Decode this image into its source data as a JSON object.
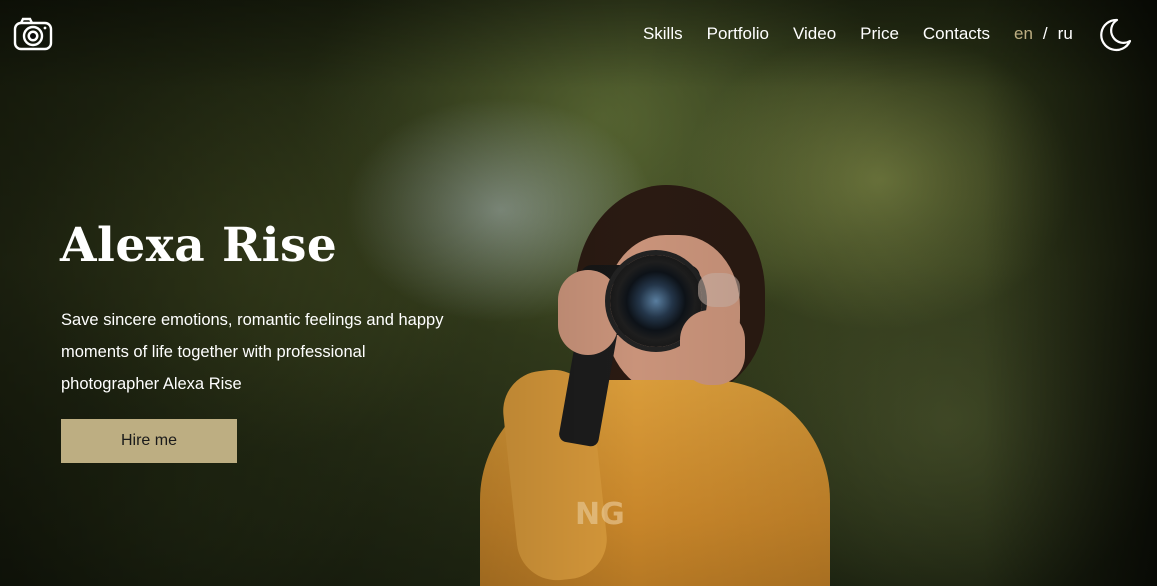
{
  "header": {
    "logo_icon": "camera-icon",
    "nav": [
      {
        "label": "Skills"
      },
      {
        "label": "Portfolio"
      },
      {
        "label": "Video"
      },
      {
        "label": "Price"
      },
      {
        "label": "Contacts"
      }
    ],
    "lang": {
      "active": "en",
      "separator": "/",
      "other": "ru"
    },
    "theme_toggle_icon": "moon-icon"
  },
  "hero": {
    "title": "Alexa Rise",
    "subtitle": "Save sincere emotions, romantic feelings and happy moments of life together with professional photographer Alexa Rise",
    "cta_label": "Hire me",
    "photo_text": "NG"
  },
  "colors": {
    "accent": "#bdae82",
    "text": "#ffffff",
    "button_text": "#1a1a1a"
  }
}
